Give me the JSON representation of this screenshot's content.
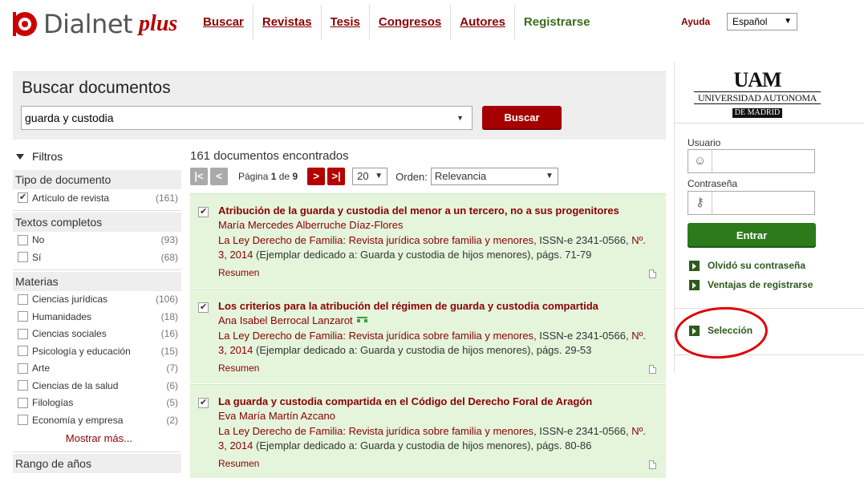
{
  "brand": {
    "name": "Dialnet",
    "plus": "plus"
  },
  "nav": {
    "items": [
      {
        "id": "buscar",
        "first": "B",
        "rest": "uscar"
      },
      {
        "id": "revistas",
        "first": "R",
        "rest": "evistas"
      },
      {
        "id": "tesis",
        "first": "T",
        "rest": "esis"
      },
      {
        "id": "congresos",
        "first": "Co",
        "rest": "ngresos"
      },
      {
        "id": "autores",
        "first": "A",
        "rest": "utores"
      },
      {
        "id": "registrarse",
        "first": "Re",
        "rest": "gistrarse"
      }
    ]
  },
  "header": {
    "help": "Ayuda",
    "language": "Español"
  },
  "search": {
    "title": "Buscar documentos",
    "query": "guarda y custodia",
    "button": "Buscar"
  },
  "filters": {
    "title": "Filtros",
    "groups": [
      {
        "title": "Tipo de documento",
        "items": [
          {
            "label": "Artículo de revista",
            "count": "(161)",
            "checked": true
          }
        ]
      },
      {
        "title": "Textos completos",
        "items": [
          {
            "label": "No",
            "count": "(93)"
          },
          {
            "label": "Sí",
            "count": "(68)"
          }
        ]
      },
      {
        "title": "Materias",
        "items": [
          {
            "label": "Ciencias jurídicas",
            "count": "(106)"
          },
          {
            "label": "Humanidades",
            "count": "(18)"
          },
          {
            "label": "Ciencias sociales",
            "count": "(16)"
          },
          {
            "label": "Psicología y educación",
            "count": "(15)"
          },
          {
            "label": "Arte",
            "count": "(7)"
          },
          {
            "label": "Ciencias de la salud",
            "count": "(6)"
          },
          {
            "label": "Filologías",
            "count": "(5)"
          },
          {
            "label": "Economía y empresa",
            "count": "(2)"
          }
        ]
      }
    ],
    "show_more": "Mostrar más...",
    "next_group": "Rango de años"
  },
  "results": {
    "count_text": "161 documentos encontrados",
    "pager": {
      "page_label": "Página",
      "page": "1",
      "of_label": "de",
      "total": "9"
    },
    "per_page": "20",
    "order_label": "Orden:",
    "order_value": "Relevancia",
    "summary_label": "Resumen",
    "items": [
      {
        "title": "Atribución de la guarda y custodia del menor a un tercero, no a sus progenitores",
        "author": "María Mercedes Alberruche Díaz-Flores",
        "journal": "La Ley Derecho de Familia: Revista jurídica sobre familia y menores",
        "issn": ", ISSN-e 2341-0566,",
        "issue": "Nº. 3, 2014",
        "details": " (Ejemplar dedicado a: Guarda y custodia de hijos menores), págs. 71-79"
      },
      {
        "title": "Los criterios para la atribución del régimen de guarda y custodia compartida",
        "author": "Ana Isabel Berrocal Lanzarot",
        "journal": "La Ley Derecho de Familia: Revista jurídica sobre familia y menores",
        "issn": ", ISSN-e 2341-0566,",
        "issue": "Nº. 3, 2014",
        "details": " (Ejemplar dedicado a: Guarda y custodia de hijos menores), págs. 29-53"
      },
      {
        "title": "La guarda y custodia compartida en el Código del Derecho Foral de Aragón",
        "author": "Eva María Martín Azcano",
        "journal": "La Ley Derecho de Familia: Revista jurídica sobre familia y menores",
        "issn": ", ISSN-e 2341-0566,",
        "issue": "Nº. 3, 2014",
        "details": " (Ejemplar dedicado a: Guarda y custodia de hijos menores), págs. 80-86"
      }
    ]
  },
  "institution": {
    "acronym": "UAM",
    "name": "UNIVERSIDAD AUTONOMA",
    "city": "DE MADRID"
  },
  "login": {
    "user_label": "Usuario",
    "password_label": "Contraseña",
    "button": "Entrar",
    "forgot": "Olvidó su contraseña",
    "benefits": "Ventajas de registrarse",
    "selection": "Selección"
  },
  "colors": {
    "brand_red": "#b30000",
    "link_green": "#2c5a1c",
    "result_bg": "#e4f5dc",
    "annotation": "#e00000"
  }
}
